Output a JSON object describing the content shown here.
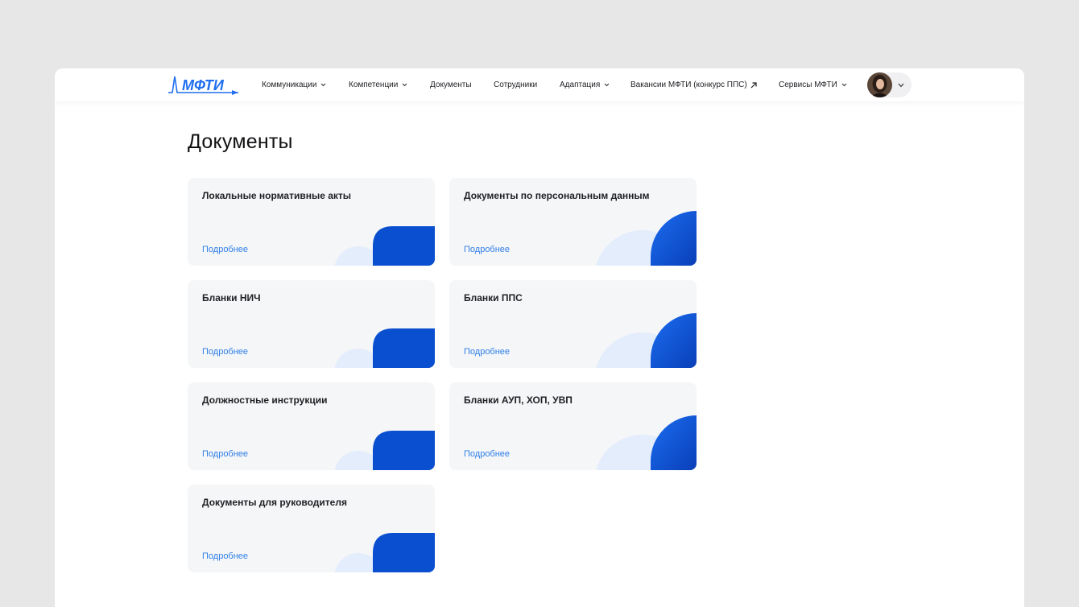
{
  "header": {
    "logo_text": "МФТИ",
    "nav": [
      {
        "label": "Коммуникации",
        "dropdown": true
      },
      {
        "label": "Компетенции",
        "dropdown": true
      },
      {
        "label": "Документы",
        "dropdown": false
      },
      {
        "label": "Сотрудники",
        "dropdown": false
      },
      {
        "label": "Адаптация",
        "dropdown": true
      },
      {
        "label": "Вакансии МФТИ (конкурс ППС)",
        "external": true
      },
      {
        "label": "Сервисы МФТИ",
        "dropdown": true
      }
    ]
  },
  "main": {
    "title": "Документы",
    "cards": [
      {
        "title": "Локальные нормативные акты",
        "link": "Подробнее",
        "style": "square"
      },
      {
        "title": "Документы по персональным данным",
        "link": "Подробнее",
        "style": "round"
      },
      {
        "title": "Бланки НИЧ",
        "link": "Подробнее",
        "style": "square"
      },
      {
        "title": "Бланки ППС",
        "link": "Подробнее",
        "style": "round"
      },
      {
        "title": "Должностные инструкции",
        "link": "Подробнее",
        "style": "square"
      },
      {
        "title": "Бланки АУП, ХОП, УВП",
        "link": "Подробнее",
        "style": "round"
      },
      {
        "title": "Документы для руководителя",
        "link": "Подробнее",
        "style": "square"
      }
    ]
  },
  "colors": {
    "accent": "#2f7fe6",
    "brand_blue": "#0a4fd0",
    "card_bg": "#f5f6f8",
    "light_shape": "#e3edfb"
  }
}
